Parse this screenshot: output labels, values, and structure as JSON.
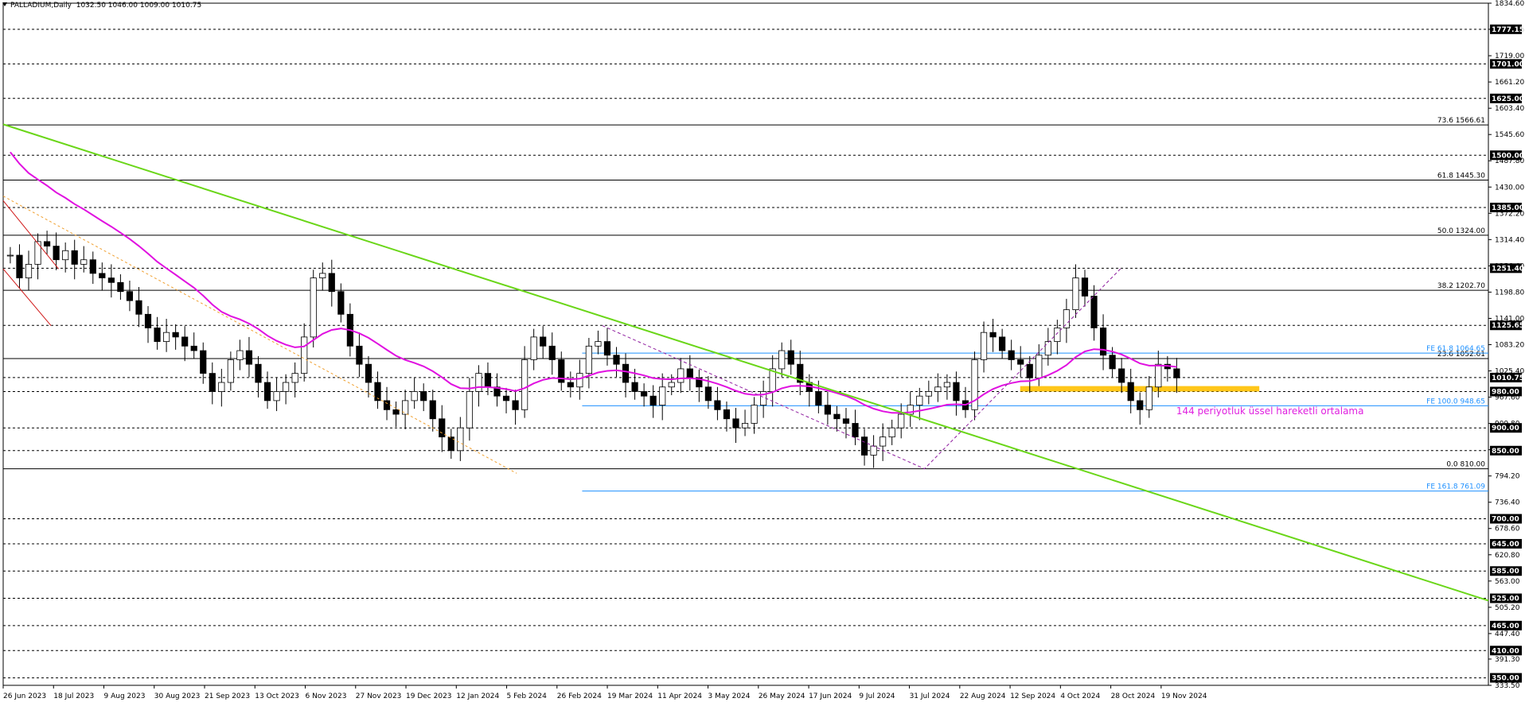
{
  "header": {
    "symbol": "PALLADIUM,Daily",
    "ohlc": "1032.50 1046.00 1009.00 1010.75"
  },
  "annotation": {
    "text": "144 periyotluk üssel hareketli ortalama",
    "color": "#e020e0"
  },
  "colors": {
    "ema": "#e010e0",
    "trendline": "#6ad618",
    "fib": "#000000",
    "fe": "#1e90ff",
    "zone": "#ffc000",
    "candle": "#000000"
  },
  "chart_data": {
    "type": "candlestick",
    "symbol": "PALLADIUM",
    "timeframe": "Daily",
    "ohlc_last": {
      "open": 1032.5,
      "high": 1046.0,
      "low": 1009.0,
      "close": 1010.75
    },
    "y_range": [
      333.5,
      1834.6
    ],
    "y_ticks": [
      "1834.60",
      "1777.15",
      "1719.00",
      "1661.20",
      "1603.40",
      "1545.60",
      "1487.80",
      "1430.00",
      "1372.20",
      "1314.40",
      "1256.60",
      "1198.80",
      "1141.00",
      "1083.20",
      "1025.40",
      "967.60",
      "909.80",
      "852.00",
      "794.20",
      "736.40",
      "678.60",
      "620.80",
      "563.00",
      "505.20",
      "447.40",
      "391.30",
      "333.50"
    ],
    "x_labels": [
      "26 Jun 2023",
      "18 Jul 2023",
      "9 Aug 2023",
      "30 Aug 2023",
      "21 Sep 2023",
      "13 Oct 2023",
      "6 Nov 2023",
      "27 Nov 2023",
      "19 Dec 2023",
      "12 Jan 2024",
      "5 Feb 2024",
      "26 Feb 2024",
      "19 Mar 2024",
      "11 Apr 2024",
      "3 May 2024",
      "26 May 2024",
      "17 Jun 2024",
      "9 Jul 2024",
      "31 Jul 2024",
      "22 Aug 2024",
      "12 Sep 2024",
      "4 Oct 2024",
      "28 Oct 2024",
      "19 Nov 2024"
    ],
    "horizontal_levels": [
      {
        "value": 1777.15,
        "label": "1777.15"
      },
      {
        "value": 1701.0,
        "label": "1701.00"
      },
      {
        "value": 1625.0,
        "label": "1625.00"
      },
      {
        "value": 1500.0,
        "label": "1500.00"
      },
      {
        "value": 1385.0,
        "label": "1385.00"
      },
      {
        "value": 1251.4,
        "label": "1251.40"
      },
      {
        "value": 1125.65,
        "label": "1125.65"
      },
      {
        "value": 1010.75,
        "label": "1010.75"
      },
      {
        "value": 980.0,
        "label": "980.00"
      },
      {
        "value": 900.0,
        "label": "900.00"
      },
      {
        "value": 850.0,
        "label": "850.00"
      },
      {
        "value": 700.0,
        "label": "700.00"
      },
      {
        "value": 645.0,
        "label": "645.00"
      },
      {
        "value": 585.0,
        "label": "585.00"
      },
      {
        "value": 525.0,
        "label": "525.00"
      },
      {
        "value": 465.0,
        "label": "465.00"
      },
      {
        "value": 410.0,
        "label": "410.00"
      },
      {
        "value": 350.0,
        "label": "350.00"
      }
    ],
    "fibonacci": [
      {
        "value": 1566.61,
        "label": "73.6 1566.61"
      },
      {
        "value": 1445.3,
        "label": "61.8 1445.30"
      },
      {
        "value": 1324.0,
        "label": "50.0 1324.00"
      },
      {
        "value": 1202.7,
        "label": "38.2 1202.70"
      },
      {
        "value": 1052.61,
        "label": "23.6 1052.61"
      },
      {
        "value": 810.0,
        "label": "0.0 810.00"
      }
    ],
    "fib_expansion": [
      {
        "value": 1064.65,
        "label": "FE 61.8 1064.65"
      },
      {
        "value": 948.65,
        "label": "FE 100.0 948.65"
      },
      {
        "value": 761.09,
        "label": "FE 161.8 761.09"
      }
    ],
    "support_zone": [
      980,
      992
    ],
    "trendline": {
      "start": [
        "26 Jun 2023",
        1568
      ],
      "end": [
        "Mar 2025",
        520
      ]
    },
    "ema_period": 144,
    "closes": [
      1280,
      1230,
      1260,
      1310,
      1300,
      1270,
      1290,
      1260,
      1270,
      1240,
      1230,
      1220,
      1200,
      1180,
      1150,
      1120,
      1090,
      1110,
      1100,
      1080,
      1070,
      1020,
      980,
      1000,
      1050,
      1070,
      1040,
      1000,
      960,
      980,
      1000,
      1020,
      1100,
      1230,
      1240,
      1200,
      1150,
      1080,
      1040,
      1000,
      960,
      940,
      930,
      960,
      980,
      960,
      920,
      880,
      850,
      900,
      980,
      1020,
      990,
      970,
      960,
      940,
      1050,
      1100,
      1080,
      1050,
      1000,
      990,
      1020,
      1080,
      1090,
      1060,
      1040,
      1000,
      980,
      970,
      950,
      990,
      1000,
      1030,
      1010,
      990,
      960,
      940,
      920,
      900,
      910,
      950,
      980,
      1030,
      1070,
      1040,
      1000,
      980,
      950,
      930,
      920,
      910,
      880,
      840,
      860,
      880,
      900,
      930,
      950,
      970,
      980,
      990,
      1000,
      960,
      940,
      1050,
      1110,
      1100,
      1070,
      1050,
      1040,
      1010,
      1060,
      1090,
      1120,
      1160,
      1230,
      1190,
      1120,
      1060,
      1030,
      1000,
      960,
      940,
      990,
      1040,
      1030,
      1010
    ]
  }
}
